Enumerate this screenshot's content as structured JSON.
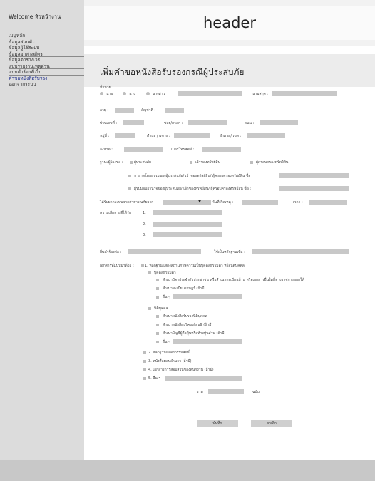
{
  "sidebar": {
    "welcome": "Welcome หัวหน้างาน",
    "items": [
      {
        "label": "เมนูหลัก"
      },
      {
        "label": "ข้อมูลส่วนตัว"
      },
      {
        "label": "ข้อมูลผู้ใช้ระบบ"
      },
      {
        "label": "ข้อมูลอาสาสมัคร"
      },
      {
        "label": "ข้อมูลตารางเวร"
      },
      {
        "label": "แบบรายงานเหตุด่วน"
      },
      {
        "label": "แบบคำร้องทั่วไป"
      },
      {
        "label": "คำขอหนังสือรับรอง"
      },
      {
        "label": "ออกจากระบบ"
      }
    ]
  },
  "header": {
    "title": "header"
  },
  "page": {
    "title": "เพิ่มคำขอหนังสือรับรองกรณีผู้ประสบภัย"
  },
  "form": {
    "name_label": "ชื่อนาย",
    "titles": [
      "นาย",
      "นาง",
      "นางสาว"
    ],
    "surname_label": "นามสกุล :",
    "age_label": "อายุ :",
    "nationality_label": "สัญชาติ :",
    "house_no_label": "บ้านเลขที่ :",
    "alley_label": "ซอย/ตรอก :",
    "road_label": "ถนน :",
    "moo_label": "หมู่ที่ :",
    "subdistrict_label": "ตำบล / แขวง :",
    "district_label": "อำเภอ / เขต :",
    "province_label": "จังหวัด :",
    "phone_label": "เบอร์โทรศัพท์ :",
    "status_label": "ฐานะผู้ร้องขอ :",
    "status_options": [
      "ผู้ประสบภัย",
      "เจ้าของทรัพย์สิน",
      "ผู้ครอบครองทรัพย์สิน"
    ],
    "option_related": "ทายาทโดยธรรมของผู้ประสบภัย/ เจ้าของทรัพย์สิน/ ผู้ครอบครองทรัพย์สิน  ชื่อ :",
    "option_authorized": "ผู้รับมอบอำนาจของผู้ประสบภัย/ เจ้าของทรัพย์สิน/ ผู้ครอบครองทรัพย์สิน  ชื่อ :",
    "disaster_type_label": "ได้รับผลกระทบจากสาธารณภัยจาก :",
    "disaster_date_label": "วันที่เกิดเหตุ :",
    "time_label": "เวลา :",
    "damage_label": "ความเสียหายที่ได้รับ :",
    "damage_numbers": [
      "1.",
      "2.",
      "3."
    ],
    "submit_to_label": "ยื่นคำร้องต่อ :",
    "purpose_label": "ใช้เป็นหลักฐานเพื่อ :",
    "attach_label": "เอกสารที่แนบมาด้วย : ",
    "attach_item1": "1. หลักฐานแสดงสถานภาพความเป็นบุคคลธรรมดา หรือนิติบุคคล",
    "natural_person": "บุคคลธรรมดา",
    "np_items": [
      "สำเนาบัตรประจำตัวประชาชน หรือสำเนาทะเบียนบ้าน หรือเอกสารอื่นใดที่ทางราชการออกให้",
      "สำเนาทะเบียนราษฎร์ (ถ้ามี)",
      "อื่น ๆ"
    ],
    "juristic_person": "นิติบุคคล",
    "jp_items": [
      "สำเนาหนังสือรับรองนิติบุคคล",
      "สำเนาหนังสือบริคณห์สนธิ (ถ้ามี)",
      "สำเนาบัญชีผู้ถือหุ้นหรือห้างหุ้นส่วน (ถ้ามี)",
      "อื่น ๆ"
    ],
    "attach_rest": [
      "2. หลักฐานแสดงกรรมสิทธิ์",
      "3. หนังสือมอบอำนาจ (ถ้ามี)",
      "4. เอกสารการสอบสวนของพนักงาน (ถ้ามี)",
      "5. อื่น ๆ"
    ],
    "total_label": "รวม",
    "copies_label": "ฉบับ"
  },
  "buttons": {
    "save": "บันทึก",
    "cancel": "ยกเลิก"
  }
}
